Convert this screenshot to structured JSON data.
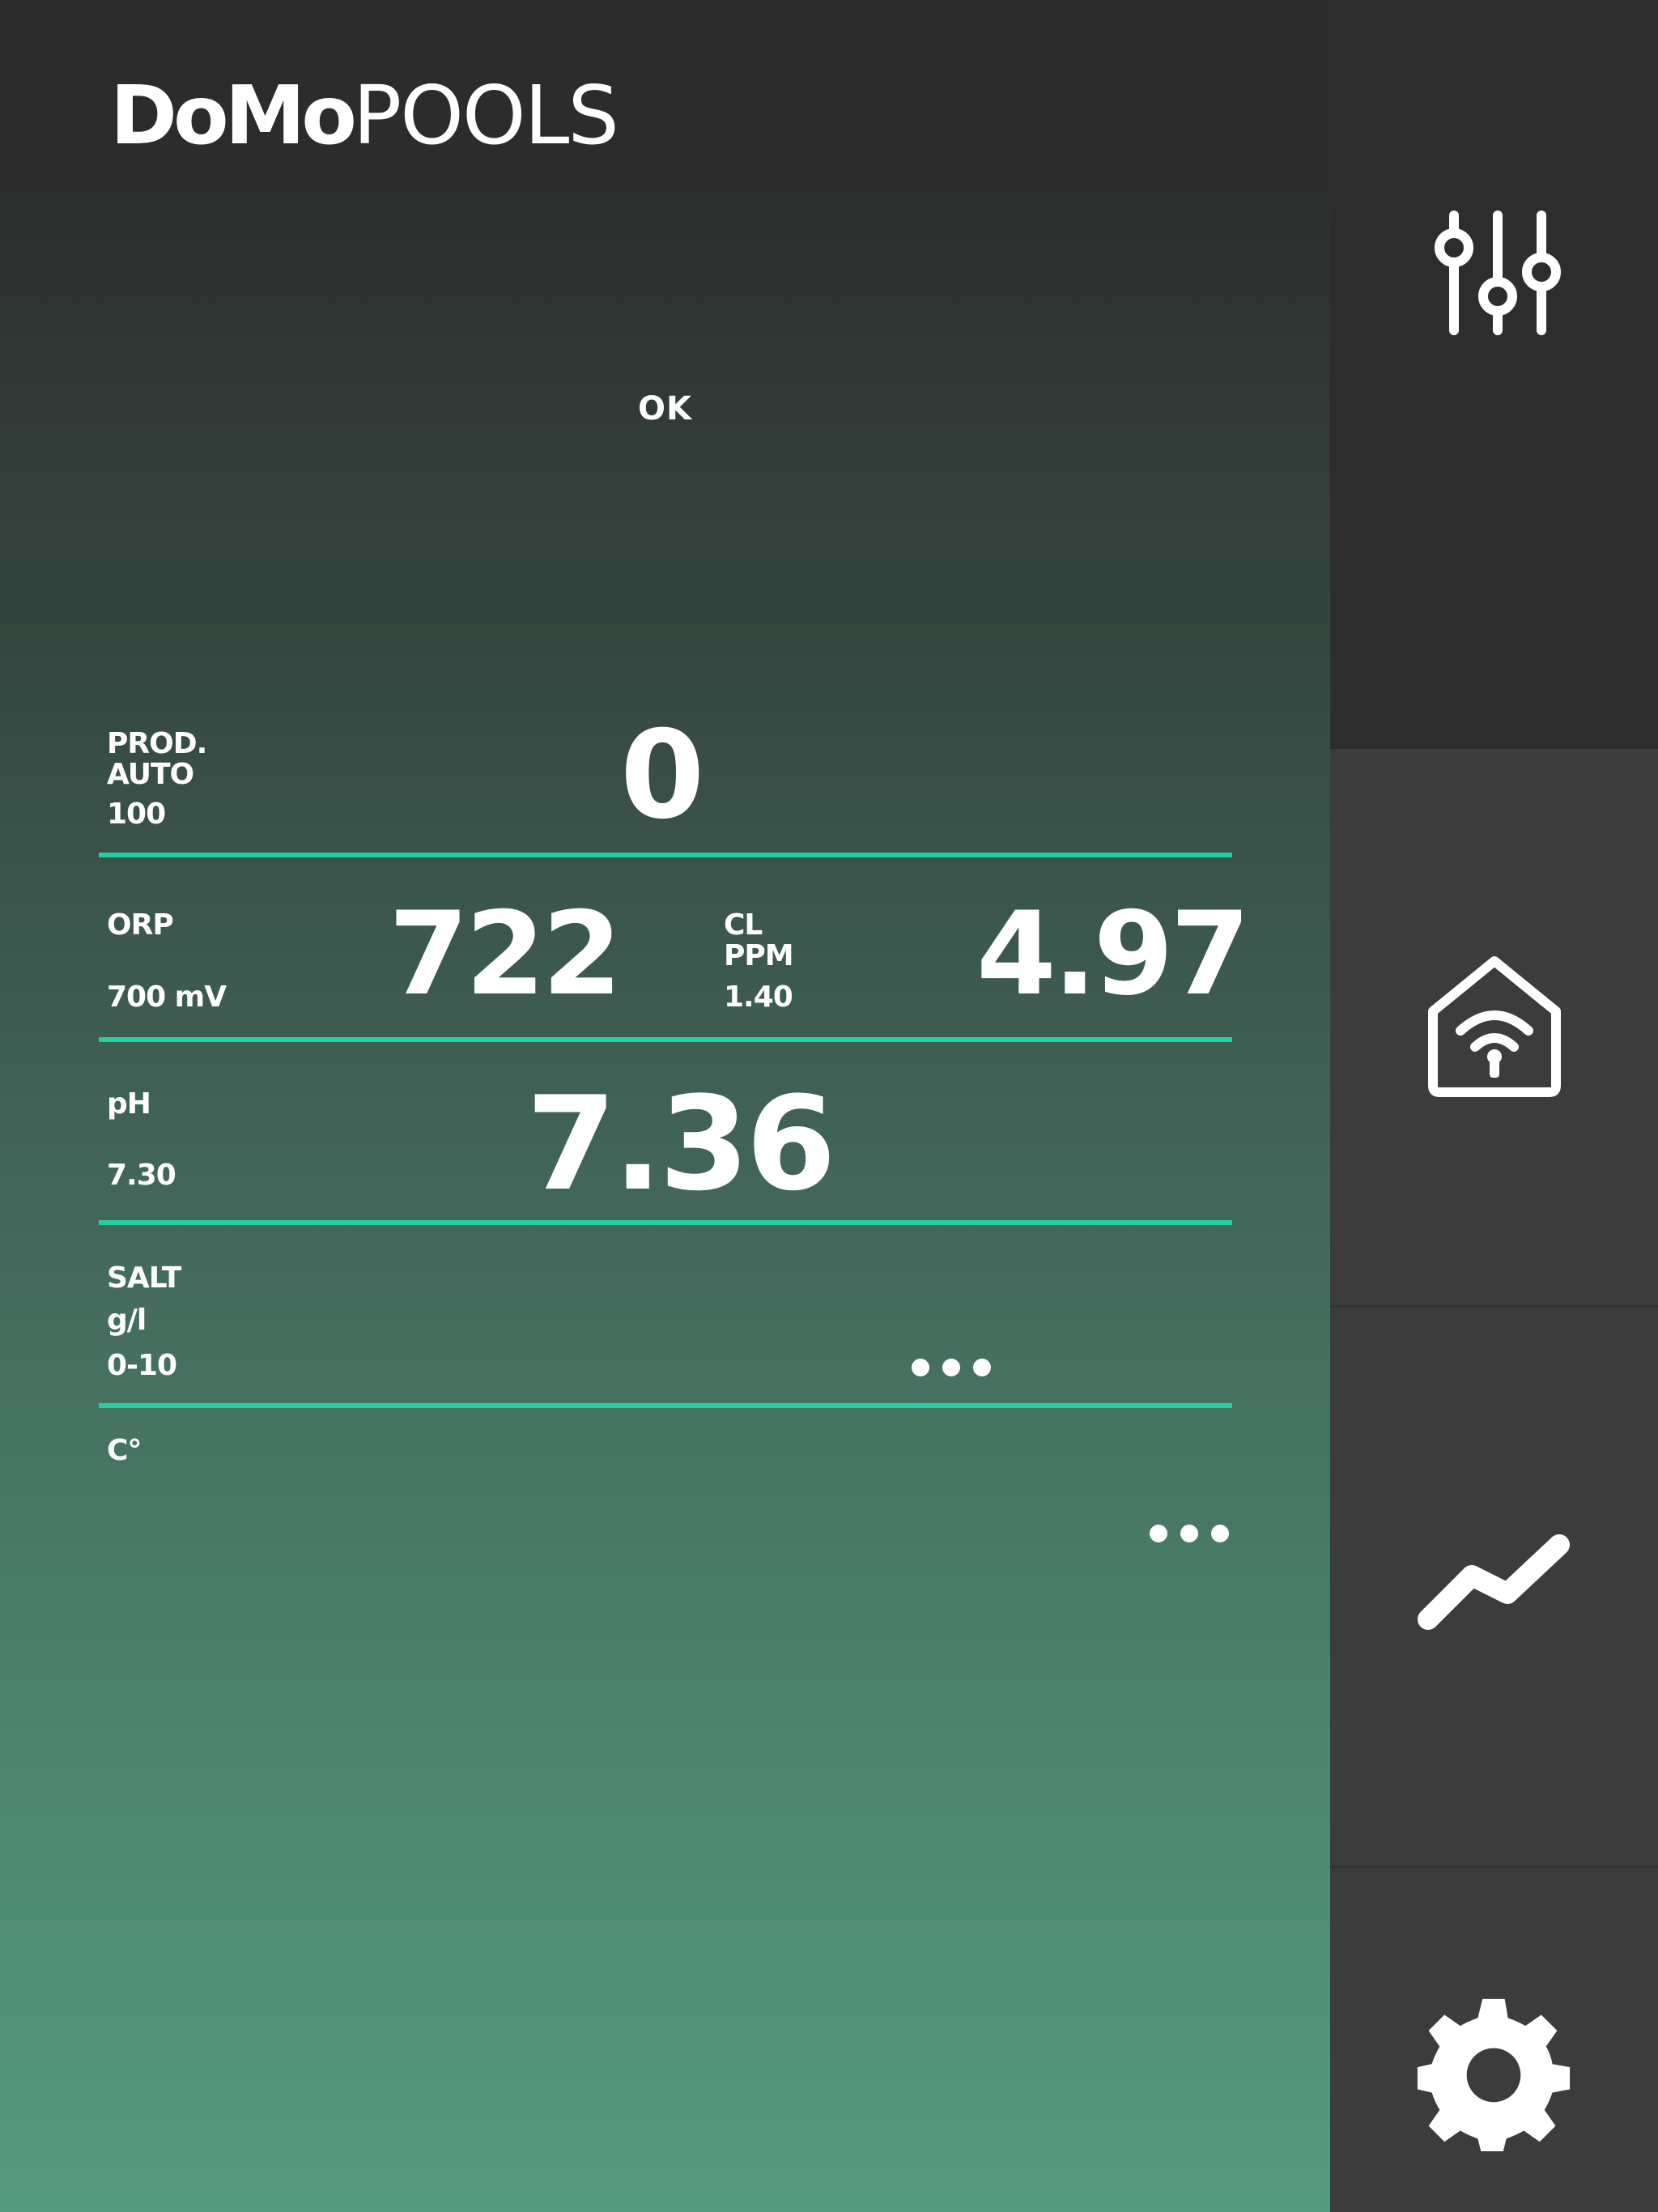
{
  "header": {
    "logo_bold": "DoMo",
    "logo_light": "POOLS"
  },
  "status": "OK",
  "production": {
    "label_line1": "PROD.",
    "label_line2": "AUTO",
    "setpoint": "100",
    "value": "0"
  },
  "orp": {
    "label": "ORP",
    "setpoint": "700 mV",
    "value": "722"
  },
  "chlorine": {
    "label_line1": "CL",
    "label_line2": "PPM",
    "setpoint": "1.40",
    "value": "4.97"
  },
  "ph": {
    "label": "pH",
    "setpoint": "7.30",
    "value": "7.36"
  },
  "salt": {
    "label_line1": "SALT",
    "label_line2": "g/l",
    "range": "0-10"
  },
  "temperature": {
    "label": "C°"
  },
  "sidebar": {
    "items": [
      {
        "icon": "sliders-icon"
      },
      {
        "icon": "smart-home-wifi-icon"
      },
      {
        "icon": "trend-chart-icon"
      },
      {
        "icon": "gear-icon"
      }
    ]
  },
  "colors": {
    "accent": "#23d0a5",
    "sidebar_bg": "#3c3c3c",
    "header_bg": "#2c2c2c"
  }
}
